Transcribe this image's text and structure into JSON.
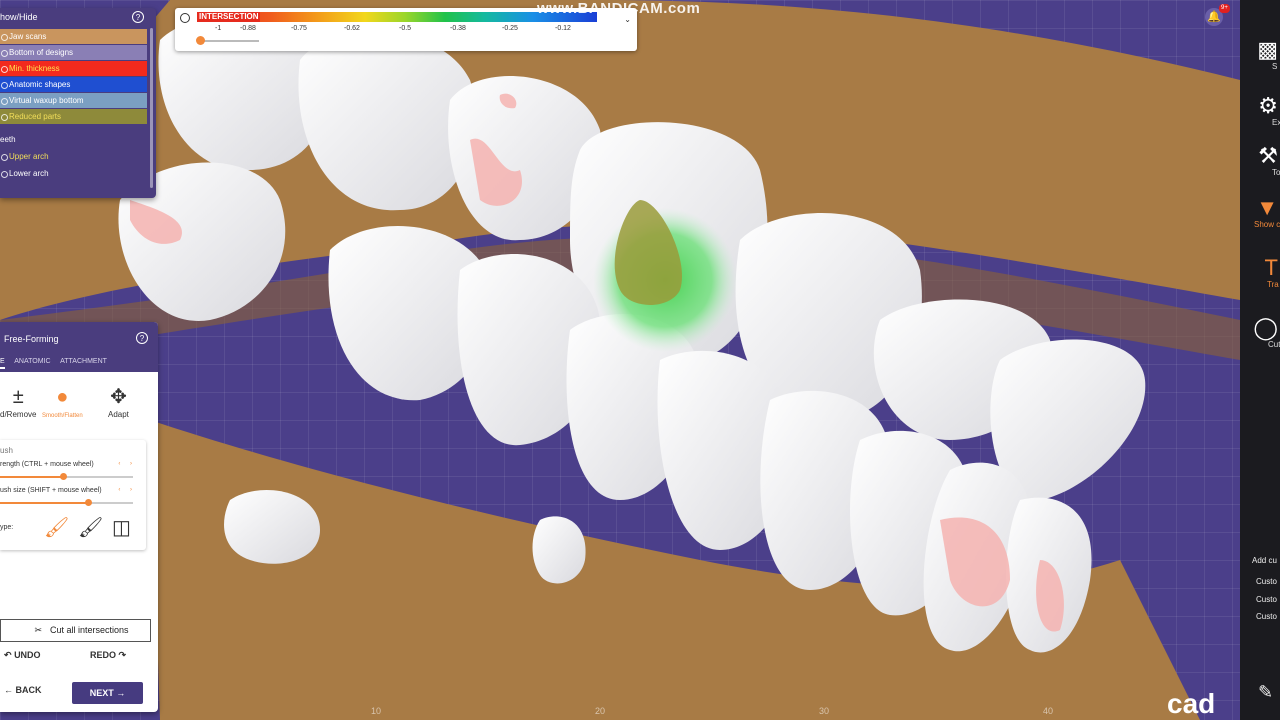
{
  "watermark": "www.BANDICAM.com",
  "brand": "cad",
  "notifications_badge": "9+",
  "legend": {
    "title": "INTERSECTION",
    "ticks": [
      "-1",
      "-0.88",
      "-0.75",
      "-0.62",
      "-0.5",
      "-0.38",
      "-0.25",
      "-0.12"
    ]
  },
  "show_hide": {
    "title": "how/Hide",
    "layers": [
      {
        "label": "Jaw scans",
        "color": "#c9955e",
        "text_color": "#ffffff"
      },
      {
        "label": "Bottom of designs",
        "color": "#8a7fb5",
        "text_color": "#ffffff"
      },
      {
        "label": "Min. thickness",
        "color": "#f32a1d",
        "text_color": "#ffe14d"
      },
      {
        "label": "Anatomic shapes",
        "color": "#1f4fd1",
        "text_color": "#ffffff"
      },
      {
        "label": "Virtual waxup bottom",
        "color": "#7b9fc2",
        "text_color": "#ffffff"
      },
      {
        "label": "Reduced parts",
        "color": "#8e8a3a",
        "text_color": "#f3df5a"
      }
    ],
    "teeth_title": "eeth",
    "arches": [
      {
        "label": "Upper arch",
        "text_color": "#f3df5a"
      },
      {
        "label": "Lower arch",
        "text_color": "#ffffff"
      }
    ]
  },
  "free_forming": {
    "title": "Free-Forming",
    "tabs": [
      "E",
      "ANATOMIC",
      "ATTACHMENT"
    ],
    "tools": [
      "d/Remove",
      "Smooth/Flatten",
      "Adapt"
    ],
    "brush": {
      "title": "ush",
      "strength_label": "rength (CTRL + mouse wheel)",
      "strength_value": 0.47,
      "size_label": "ush size (SHIFT + mouse wheel)",
      "size_value": 0.66,
      "type_label": "ype:"
    },
    "cut_all": "Cut all intersections",
    "undo": "UNDO",
    "redo": "REDO",
    "back": "BACK",
    "next": "NEXT"
  },
  "right_toolbar": {
    "items": [
      {
        "label": "S",
        "icon": "save-icon"
      },
      {
        "label": "Ex",
        "icon": "expert-icon"
      },
      {
        "label": "To",
        "icon": "tools-icon"
      },
      {
        "label": "Show c",
        "icon": "show-collision-icon"
      },
      {
        "label": "Tra",
        "icon": "transparency-icon"
      },
      {
        "label": "Cut",
        "icon": "cut-icon"
      }
    ],
    "add_custom": "Add cu",
    "custom_items": [
      "Custo",
      "Custo",
      "Custo"
    ]
  },
  "scale_ticks": [
    "10",
    "20",
    "30",
    "40"
  ],
  "colors": {
    "accent": "#f2893a",
    "panel_purple": "#4a3d7e",
    "background_grid": "#4b3f8a",
    "gum": "#a87b45",
    "tooth": "#f2f2f4",
    "contact_green": "#3fd04a",
    "contact_pink": "#f4b3b0"
  }
}
